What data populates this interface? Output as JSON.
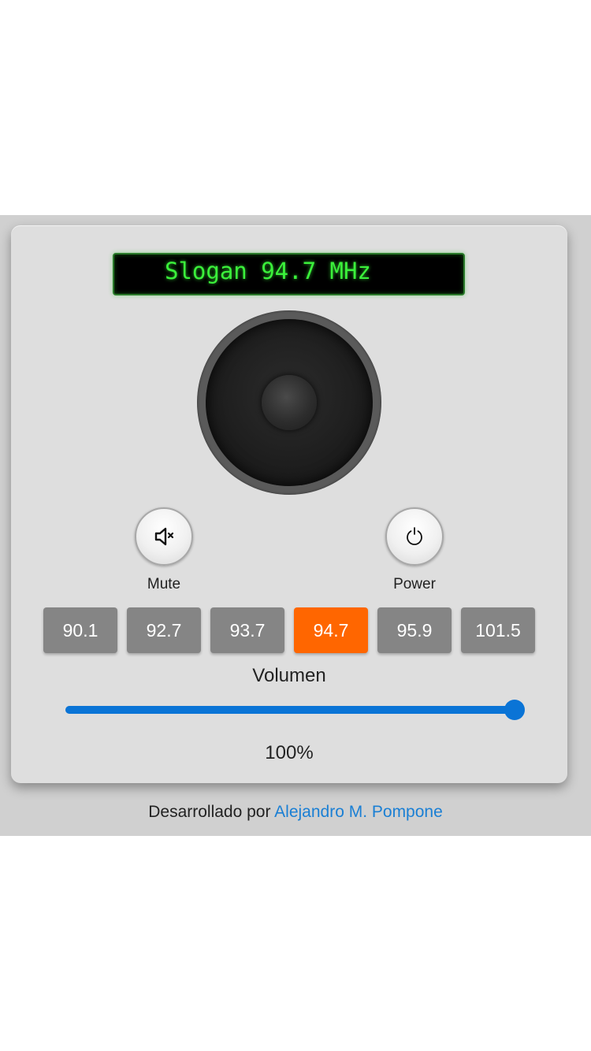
{
  "display": {
    "text": "Slogan 94.7 MHz"
  },
  "controls": {
    "mute_label": "Mute",
    "power_label": "Power"
  },
  "presets": {
    "items": [
      "90.1",
      "92.7",
      "93.7",
      "94.7",
      "95.9",
      "101.5"
    ],
    "active_index": 3
  },
  "volume": {
    "title": "Volumen",
    "value_text": "100%",
    "level": 1.0
  },
  "footer": {
    "prefix": "Desarrollado por",
    "author": "Alejandro M. Pompone"
  },
  "colors": {
    "display_text": "#3bf03b",
    "preset": "#858585",
    "preset_active": "#ff6600",
    "slider": "#0a74d6",
    "link": "#1a7fd4"
  }
}
